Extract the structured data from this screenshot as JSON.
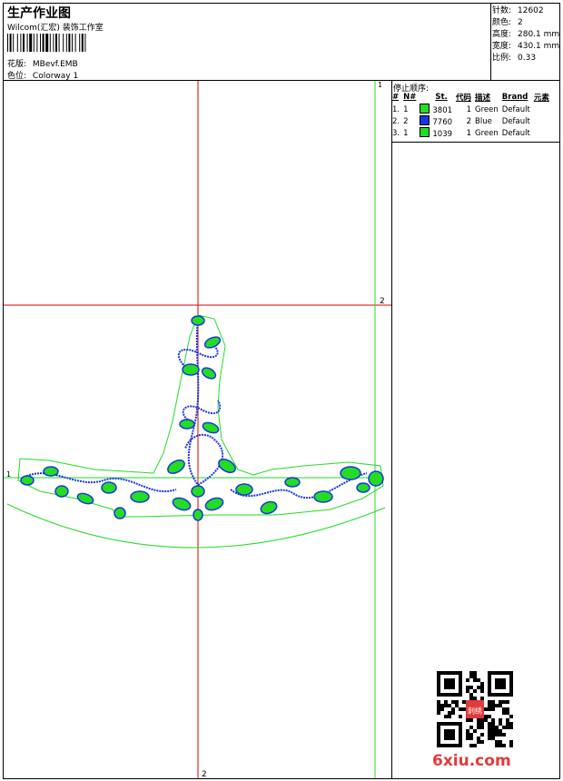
{
  "header": {
    "title": "生产作业图",
    "subtitle": "Wilcom(汇宏) 装饰工作室",
    "design_label": "花版:",
    "design_value": "MBevf.EMB",
    "colorway_label": "色位:",
    "colorway_value": "Colorway 1"
  },
  "stats": [
    {
      "label": "针数:",
      "value": "12602"
    },
    {
      "label": "颜色:",
      "value": "2"
    },
    {
      "label": "高度:",
      "value": "280.1 mm"
    },
    {
      "label": "宽度:",
      "value": "430.1 mm"
    },
    {
      "label": "比例:",
      "value": "0.33"
    }
  ],
  "stop_sequence": {
    "title": "停止顺序:",
    "columns": [
      "#",
      "N#",
      "St.",
      "代码",
      "描述",
      "Brand",
      "元素"
    ],
    "rows": [
      {
        "index": "1.",
        "n": "1",
        "color": "#22dd22",
        "stitches": "3801",
        "code": "1",
        "description": "Green",
        "brand": "Default",
        "element": ""
      },
      {
        "index": "2.",
        "n": "2",
        "color": "#1a35e0",
        "stitches": "7760",
        "code": "2",
        "description": "Blue",
        "brand": "Default",
        "element": ""
      },
      {
        "index": "3.",
        "n": "1",
        "color": "#22dd22",
        "stitches": "1039",
        "code": "1",
        "description": "Green",
        "brand": "Default",
        "element": ""
      }
    ]
  },
  "guides": {
    "marker_1": "1",
    "marker_2": "2",
    "guide_color": "#dd0000",
    "outline_color": "#22dd22",
    "stitch_color": "#1a35e0"
  },
  "watermark": "6xiu.com",
  "qr_stamp": "刺绣"
}
